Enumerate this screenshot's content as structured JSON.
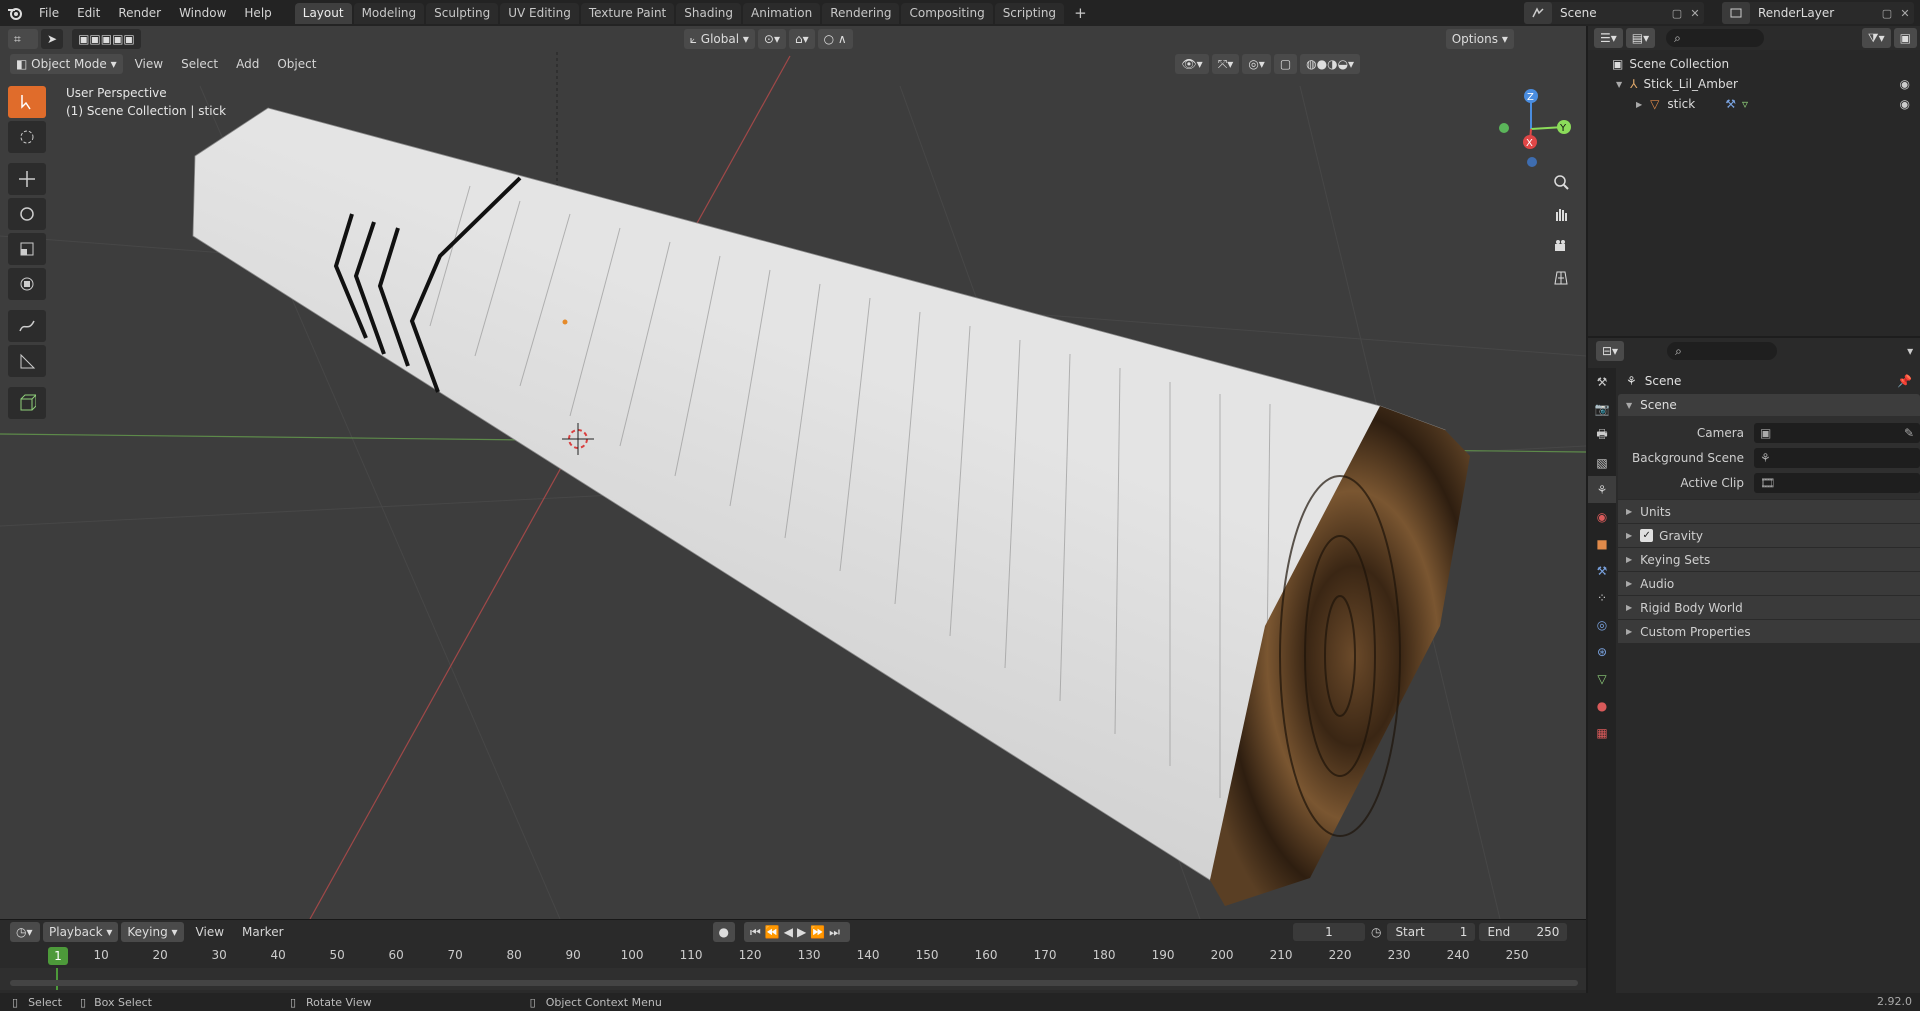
{
  "menubar": {
    "file": "File",
    "edit": "Edit",
    "render": "Render",
    "window": "Window",
    "help": "Help"
  },
  "workspaces": [
    "Layout",
    "Modeling",
    "Sculpting",
    "UV Editing",
    "Texture Paint",
    "Shading",
    "Animation",
    "Rendering",
    "Compositing",
    "Scripting"
  ],
  "workspace_add": "+",
  "scene_selector": {
    "name": "Scene"
  },
  "renderlayer_selector": {
    "name": "RenderLayer"
  },
  "viewport": {
    "mode": "Object Mode",
    "menus": {
      "view": "View",
      "select": "Select",
      "add": "Add",
      "object": "Object"
    },
    "orientation": "Global",
    "options": "Options",
    "info_line1": "User Perspective",
    "info_line2": "(1) Scene Collection | stick",
    "gizmo": {
      "x": "X",
      "y": "Y",
      "z": "Z"
    }
  },
  "outliner": {
    "root": "Scene Collection",
    "items": [
      {
        "label": "Stick_Lil_Amber"
      },
      {
        "label": "stick"
      }
    ]
  },
  "properties": {
    "context": "Scene",
    "panel": "Scene",
    "fields": [
      {
        "label": "Camera"
      },
      {
        "label": "Background Scene"
      },
      {
        "label": "Active Clip"
      }
    ],
    "subpanels": [
      {
        "label": "Units"
      },
      {
        "label": "Gravity",
        "checked": true
      },
      {
        "label": "Keying Sets"
      },
      {
        "label": "Audio"
      },
      {
        "label": "Rigid Body World"
      },
      {
        "label": "Custom Properties"
      }
    ]
  },
  "timeline": {
    "playback": "Playback",
    "keying": "Keying",
    "view": "View",
    "marker": "Marker",
    "current_frame": "1",
    "start_label": "Start",
    "start": "1",
    "end_label": "End",
    "end": "250",
    "ticks": [
      "10",
      "20",
      "30",
      "40",
      "50",
      "60",
      "70",
      "80",
      "90",
      "100",
      "110",
      "120",
      "130",
      "140",
      "150",
      "160",
      "170",
      "180",
      "190",
      "200",
      "210",
      "220",
      "230",
      "240",
      "250"
    ]
  },
  "statusbar": {
    "select": "Select",
    "box_select": "Box Select",
    "rotate_view": "Rotate View",
    "context_menu": "Object Context Menu",
    "version": "2.92.0"
  },
  "colors": {
    "accent": "#4772b3",
    "active_tool": "#e06c2b",
    "frame_marker": "#4d9a3a",
    "axis_x": "#e04747",
    "axis_y": "#8bdc5a",
    "axis_z": "#4a8de0"
  }
}
